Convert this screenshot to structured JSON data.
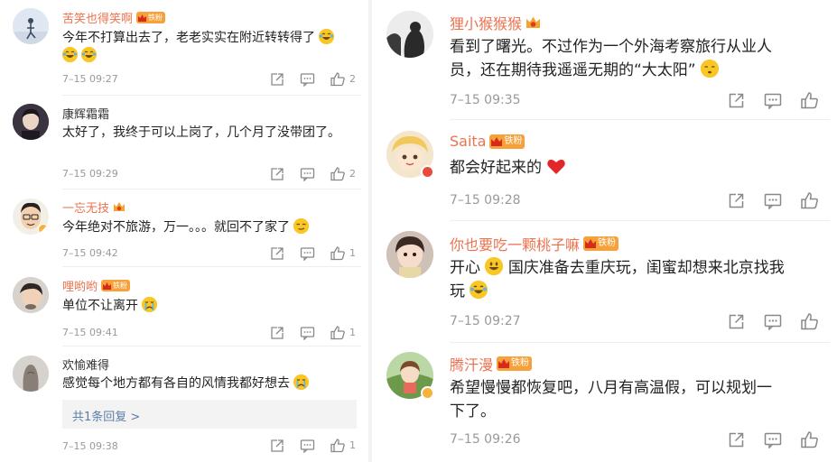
{
  "left": [
    {
      "name": "苦笑也得笑啊",
      "badge": "铁粉",
      "crown": true,
      "text": "今年不打算出去了，老老实实在附近转转得了",
      "emojis": [
        "laugh",
        "laugh",
        "laugh"
      ],
      "time": "7–15 09:27",
      "likes": "2"
    },
    {
      "name": "康辉霜霜",
      "badge": "",
      "crown": false,
      "text": "太好了，我终于可以上岗了，几个月了没带团了。",
      "time": "7–15 09:29",
      "likes": "2"
    },
    {
      "name": "一忘无技",
      "badge": "",
      "crown": true,
      "text": "今年绝对不旅游，万一。。。就回不了家了",
      "emojis": [
        "smirk"
      ],
      "time": "7–15 09:42",
      "likes": "1"
    },
    {
      "name": "哩哟哟",
      "badge": "铁粉",
      "crown": true,
      "text": "单位不让离开",
      "emojis": [
        "cry"
      ],
      "time": "7–15 09:41",
      "likes": "1"
    },
    {
      "name": "欢愉难得",
      "badge": "",
      "crown": false,
      "text": "感觉每个地方都有各自的风情我都好想去",
      "emojis": [
        "cry"
      ],
      "reply": "共1条回复 >",
      "time": "7–15 09:38",
      "likes": "1"
    }
  ],
  "right": [
    {
      "name": "狸小猴猴猴",
      "badge": "",
      "crown": true,
      "text_lines": [
        "看到了曙光。不过作为一个外海考察旅行从业人",
        "员，还在期待我遥遥无期的“大太阳”"
      ],
      "emojis": [
        "sleepy"
      ],
      "time": "7–15 09:35"
    },
    {
      "name": "Saita",
      "badge": "铁粉",
      "crown": true,
      "text": "都会好起来的",
      "emojis": [
        "heart"
      ],
      "time": "7–15 09:28"
    },
    {
      "name": "你也要吃一颗桃子嘛",
      "badge": "铁粉",
      "crown": true,
      "text_lines": [
        "开心",
        "国庆准备去重庆玩，闺蜜却想来北京找我",
        "玩"
      ],
      "emojis": [
        "grin",
        "laugh"
      ],
      "time": "7–15 09:27"
    },
    {
      "name": "腾汗漫",
      "badge": "铁粉",
      "crown": true,
      "text_lines": [
        "希望慢慢都恢复吧，八月有高温假，可以规划一",
        "下了。"
      ],
      "time": "7–15 09:26"
    }
  ],
  "colors": {
    "name": "#eb7350",
    "time": "#999999",
    "badge": "#f7a13a",
    "reply": "#5b7ea8"
  },
  "icons": [
    "share-icon",
    "comment-icon",
    "like-icon",
    "crown-icon"
  ]
}
